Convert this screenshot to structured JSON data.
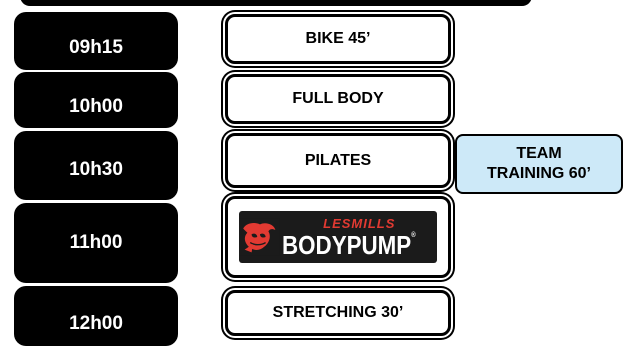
{
  "schedule": [
    {
      "time": "09h15",
      "class": "BIKE 45’"
    },
    {
      "time": "10h00",
      "class": "FULL BODY"
    },
    {
      "time": "10h30",
      "class": "PILATES",
      "extra_line1": "TEAM",
      "extra_line2": "TRAINING 60’"
    },
    {
      "time": "11h00",
      "logo": {
        "small": "LESMILLS",
        "big": "BODYPUMP",
        "mark": "®"
      }
    },
    {
      "time": "12h00",
      "class": "STRETCHING 30’"
    }
  ],
  "colors": {
    "time_bg": "#000000",
    "team_bg": "#cde9f8",
    "logo_red": "#e23a32"
  }
}
